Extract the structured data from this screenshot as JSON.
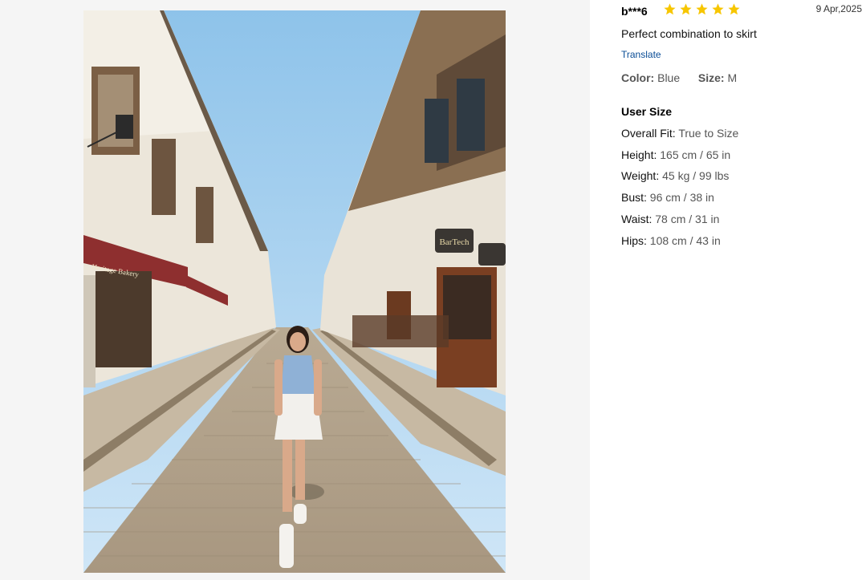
{
  "review": {
    "reviewer": "b***6",
    "rating": 5,
    "date": "9 Apr,2025",
    "text": "Perfect combination to skirt",
    "translate_label": "Translate",
    "color_label": "Color:",
    "color_value": "Blue",
    "size_label": "Size:",
    "size_value": "M"
  },
  "user_size": {
    "title": "User Size",
    "rows": [
      {
        "label": "Overall Fit:",
        "value": "True to Size"
      },
      {
        "label": "Height:",
        "value": "165 cm / 65 in"
      },
      {
        "label": "Weight:",
        "value": "45 kg / 99 lbs"
      },
      {
        "label": "Bust:",
        "value": "96 cm / 38 in"
      },
      {
        "label": "Waist:",
        "value": "78 cm / 31 in"
      },
      {
        "label": "Hips:",
        "value": "108 cm / 43 in"
      }
    ]
  },
  "photo": {
    "shop_sign_left": "Heritage Bakery",
    "shop_sign_right": "BarTech"
  },
  "colors": {
    "star": "#f7c600",
    "link": "#0a4d96"
  }
}
